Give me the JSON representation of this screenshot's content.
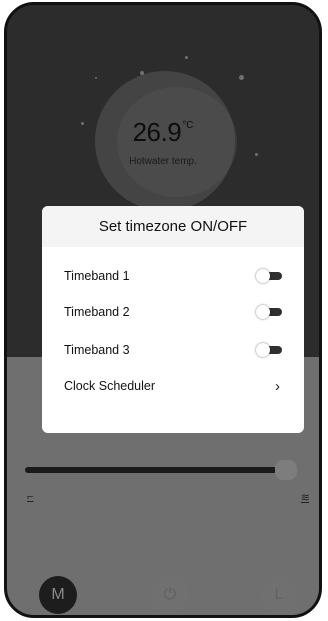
{
  "main": {
    "temperature_value": "26.9",
    "temperature_unit": "°C",
    "temperature_label": "Hotwater temp."
  },
  "dialog": {
    "title": "Set timezone ON/OFF",
    "items": [
      {
        "label": "Timeband 1",
        "state": "off"
      },
      {
        "label": "Timeband 2",
        "state": "off"
      },
      {
        "label": "Timeband 3",
        "state": "off"
      },
      {
        "label": "Clock Scheduler",
        "icon": "chevron-right-icon"
      }
    ]
  },
  "slider": {
    "min_icon": "low-heat-icon",
    "max_icon": "high-heat-icon"
  },
  "modes": [
    {
      "label": "M",
      "icon": "manual-mode-icon",
      "active": true
    },
    {
      "label": "",
      "icon": "power-icon",
      "active": false
    },
    {
      "label": "",
      "icon": "clock-mode-icon",
      "active": false
    }
  ],
  "colors": {
    "overlay_dark": "#2c2c2c",
    "overlay_mid": "#6f6f6f",
    "dialog_bg": "#ffffff",
    "toggle_track": "#2f2f2f"
  }
}
